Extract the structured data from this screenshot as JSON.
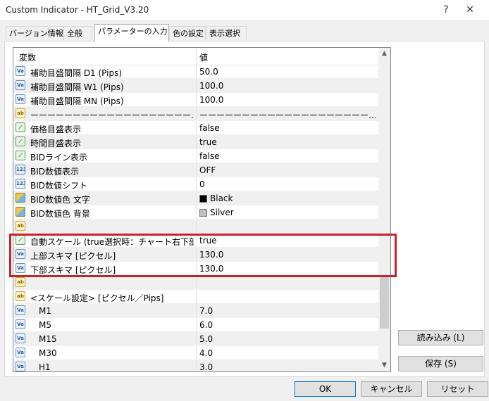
{
  "window": {
    "title": "Custom Indicator - HT_Grid_V3.20",
    "help_label": "?",
    "close_label": "✕"
  },
  "tabs": [
    {
      "label": "バージョン情報"
    },
    {
      "label": "全般"
    },
    {
      "label": "パラメーターの入力"
    },
    {
      "label": "色の設定"
    },
    {
      "label": "表示選択"
    }
  ],
  "grid": {
    "header_name": "変数",
    "header_value": "値",
    "rows": [
      {
        "type": "double",
        "icon_text": "Va",
        "name": "補助目盛間隔 D1 (Pips)",
        "value": "50.0"
      },
      {
        "type": "double",
        "icon_text": "Va",
        "name": "補助目盛間隔 W1 (Pips)",
        "value": "100.0"
      },
      {
        "type": "double",
        "icon_text": "Va",
        "name": "補助目盛間隔 MN (Pips)",
        "value": "100.0"
      },
      {
        "type": "string",
        "icon_text": "ab",
        "name": "ーーーーーーーーーーーーーーーーーーー…",
        "value": "ーーーーーーーーーーーーーーーーーーーー…"
      },
      {
        "type": "bool",
        "icon_text": "⟋",
        "name": "価格目盛表示",
        "value": "false"
      },
      {
        "type": "bool",
        "icon_text": "⟋",
        "name": "時間目盛表示",
        "value": "true"
      },
      {
        "type": "bool",
        "icon_text": "⟋",
        "name": "BIDライン表示",
        "value": "false"
      },
      {
        "type": "int",
        "icon_text": "123",
        "name": "BID数値表示",
        "value": "OFF"
      },
      {
        "type": "int",
        "icon_text": "123",
        "name": "BID数値シフト",
        "value": "0"
      },
      {
        "type": "color",
        "icon_text": "",
        "name": "BID数値色 文字",
        "value": "Black",
        "swatch": "#000000"
      },
      {
        "type": "color",
        "icon_text": "",
        "name": "BID数値色 背景",
        "value": "Silver",
        "swatch": "#c0c0c0"
      },
      {
        "type": "string",
        "icon_text": "ab",
        "name": "",
        "value": ""
      },
      {
        "type": "bool",
        "icon_text": "⟋",
        "name": "自動スケール (true選択時：チャート右下部クリ…",
        "value": "true"
      },
      {
        "type": "double",
        "icon_text": "Va",
        "name": "上部スキマ [ピクセル]",
        "value": "130.0"
      },
      {
        "type": "double",
        "icon_text": "Va",
        "name": "下部スキマ [ピクセル]",
        "value": "130.0"
      },
      {
        "type": "string",
        "icon_text": "ab",
        "name": "",
        "value": ""
      },
      {
        "type": "string",
        "icon_text": "ab",
        "name": "<スケール設定> [ピクセル／Pips]",
        "value": ""
      },
      {
        "type": "double",
        "icon_text": "Va",
        "name": "M1",
        "value": "7.0",
        "indent": true
      },
      {
        "type": "double",
        "icon_text": "Va",
        "name": "M5",
        "value": "6.0",
        "indent": true
      },
      {
        "type": "double",
        "icon_text": "Va",
        "name": "M15",
        "value": "5.0",
        "indent": true
      },
      {
        "type": "double",
        "icon_text": "Va",
        "name": "M30",
        "value": "4.0",
        "indent": true
      },
      {
        "type": "double",
        "icon_text": "Va",
        "name": "H1",
        "value": "3.0",
        "indent": true
      }
    ]
  },
  "side_buttons": {
    "load": "読み込み (L)",
    "save": "保存 (S)"
  },
  "footer_buttons": {
    "ok": "OK",
    "cancel": "キャンセル",
    "reset": "リセット"
  },
  "colors": {
    "highlight": "#c8232c"
  }
}
